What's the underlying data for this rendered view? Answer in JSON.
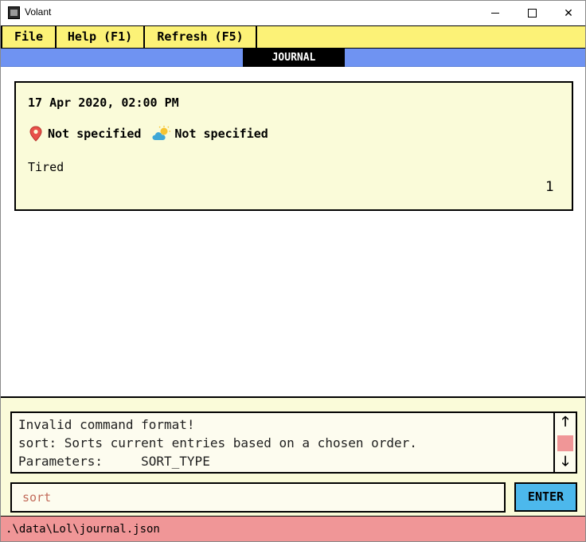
{
  "window": {
    "title": "Volant",
    "controls": {
      "minimize": "minimize",
      "maximize": "maximize",
      "close": "✕"
    }
  },
  "menu": {
    "items": [
      {
        "label": "File"
      },
      {
        "label": "Help (F1)"
      },
      {
        "label": "Refresh (F5)"
      }
    ]
  },
  "tabs": {
    "active": "JOURNAL"
  },
  "entry": {
    "datetime": "17 Apr 2020,  02:00 PM",
    "location": "Not specified",
    "weather": "Not specified",
    "text": "Tired",
    "index": "1",
    "location_icon": "map-pin-icon",
    "weather_icon": "partly-cloudy-icon"
  },
  "result": {
    "lines": [
      "Invalid command format!",
      "sort: Sorts current entries based on a chosen order.",
      "Parameters:     SORT_TYPE"
    ],
    "scroll_up": "🡑",
    "scroll_down": "🡓"
  },
  "command": {
    "value": "sort",
    "enter_label": "ENTER"
  },
  "status": {
    "path": ".\\data\\Lol\\journal.json"
  },
  "colors": {
    "menu_bg": "#fcf277",
    "tabbar_bg": "#6f93f2",
    "card_bg": "#fafbd9",
    "enter_bg": "#4cb8ec",
    "status_bg": "#f09697",
    "input_text": "#c26b5a"
  }
}
